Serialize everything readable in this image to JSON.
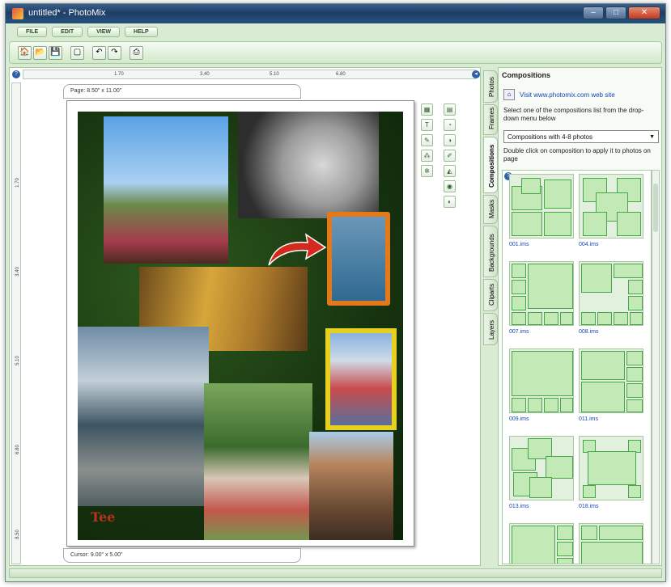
{
  "window": {
    "title": "untitled* - PhotoMix"
  },
  "menu": [
    "FILE",
    "EDIT",
    "VIEW",
    "HELP"
  ],
  "ruler": {
    "h_ticks": [
      "1.70",
      "3.40",
      "5.10",
      "6.80"
    ],
    "v_ticks": [
      "1.70",
      "3.40",
      "5.10",
      "6.80",
      "8.50"
    ]
  },
  "canvas": {
    "page_size": "Page: 8.50\" x 11.00\"",
    "cursor": "Cursor: 9.00\" x 5.00\"",
    "collage_text": "Tee"
  },
  "tabs": [
    "Photos",
    "Frames",
    "Compositions",
    "Masks",
    "Backgrounds",
    "Cliparts",
    "Layers"
  ],
  "panel": {
    "title": "Compositions",
    "link": "Visit www.photomix.com web site",
    "instruction": "Select one of the compositions list from the drop-down menu below",
    "dropdown_value": "Compositions with 4-8 photos",
    "hint": "Double click on composition to apply it to photos on page"
  },
  "compositions": [
    "001.ims",
    "004.ims",
    "007.ims",
    "008.ims",
    "009.ims",
    "011.ims",
    "013.ims",
    "018.ims"
  ],
  "colors": {
    "accent_green": "#48a64a",
    "link_blue": "#1a44b8",
    "titlebar": "#1e3e66"
  }
}
